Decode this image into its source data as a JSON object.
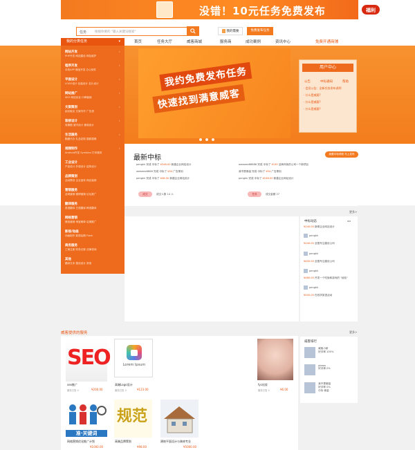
{
  "top_banner": {
    "headline": "没错！10元任务免费发布",
    "badge": "福利"
  },
  "search": {
    "select_label": "任务",
    "placeholder": "搜搜你要的 \"输入关键词搜索\"",
    "button_icon": "search-icon"
  },
  "header_buttons": {
    "publish_label": "我的需要",
    "register_label": "免费发布任务"
  },
  "nav": {
    "category_label": "我的分类任务",
    "items": [
      "首页",
      "任务大厅",
      "威客商城",
      "服务商",
      "成功案例",
      "资讯中心"
    ],
    "highlight": "免费开通商铺"
  },
  "sidebar": {
    "groups": [
      {
        "title": "网站开发",
        "items": "PHP开发  网站建设  网站维护"
      },
      {
        "title": "程序开发",
        "items": "手机APP  微信开发  办公软件"
      },
      {
        "title": "平面设计",
        "items": "LOGO设计  包装设计  名片设计"
      },
      {
        "title": "网站推广",
        "items": "SEO  网站优化  口碑营销"
      },
      {
        "title": "文案策划",
        "items": "起名取名  文案写作  广告语"
      },
      {
        "title": "装修设计",
        "items": "效果图  室内设计  景观设计"
      },
      {
        "title": "生活服务",
        "items": "跑腿代办  礼品定制  摄影摄像"
      },
      {
        "title": "视频制作",
        "items": "Android开发  Symbian  打印服务"
      },
      {
        "title": "工业设计",
        "items": "产品设计  外观设计  结构设计"
      },
      {
        "title": "品牌策划",
        "items": "活动策划  企业宣传  网店装修"
      },
      {
        "title": "营销服务",
        "items": "全网营销  微博营销  论坛推广"
      },
      {
        "title": "翻译服务",
        "items": "英语翻译  日语翻译  韩语翻译"
      },
      {
        "title": "网络营销",
        "items": "微信营销  淘宝刷单  店铺推广"
      },
      {
        "title": "影视/动画",
        "items": "动画制作  影视后期  Flash"
      },
      {
        "title": "商务服务",
        "items": "工商注册  财务记账  法律咨询"
      },
      {
        "title": "其他",
        "items": "翻译文本  整站设计  其他"
      }
    ]
  },
  "hero": {
    "line1": "我约免费发布任务",
    "line2": "快速找到满意威客"
  },
  "user_panel": {
    "title": "用户中心",
    "tabs": [
      "公告",
      "中标通知",
      "帮助"
    ],
    "items": [
      "· 会员公告：全新任务发布说明",
      "· 什么是威客?",
      "· 什么是威客?",
      "· 什么是威客?"
    ]
  },
  "latest": {
    "title": "最新中标",
    "action_label": "我要中标领钱  马上发布",
    "rows": [
      {
        "text": "pengkk 完成 中标了",
        "amount": "¥248.00",
        "tail": "新建企业网站设计"
      },
      {
        "text": "weweee6666 完成 中标了",
        "amount": "¥54",
        "tail": "广告策划"
      },
      {
        "text": "pengkk 完成 中标了",
        "amount": "¥48.00",
        "tail": "新建企业网站设计"
      },
      {
        "text": "weweee88888 完成 中标了",
        "amount": "¥135",
        "tail": "这两年我的公司一个新项目"
      },
      {
        "text": "我不是佛祖 完成 中标了",
        "amount": "¥54",
        "tail": "广告策划"
      },
      {
        "text": "pengkk 完成 中标了",
        "amount": "¥248.00",
        "tail": "新建企业网站设计"
      }
    ],
    "stat1_label": "成交",
    "stat1_text": "成交人数 14 人",
    "stat2_label": "任务",
    "stat2_text": "成交金额 27"
  },
  "more_label": "更多>",
  "activity": {
    "title": "中标动态",
    "rows": [
      {
        "amount": "¥240.00",
        "text": "新闻企业网站设计"
      },
      {
        "user": "pengkk",
        "amount": "¥240.00",
        "text": "全国专注建设公司"
      },
      {
        "user": "pengkk",
        "amount": "¥400.00",
        "text": "全国专注建设公司"
      },
      {
        "user": "pengkk",
        "amount": "¥480.00",
        "text": "开发一个吃饭和游戏的 \"经验\""
      },
      {
        "user": "pengkk",
        "amount": "¥500.00",
        "text": "在线学英语活动"
      }
    ]
  },
  "services": {
    "title": "威客提供的服务",
    "products": [
      {
        "name": "seo推广",
        "meta": "服务已售 0",
        "price": "¥200.00"
      },
      {
        "name": "高端Logo设计",
        "meta": "服务已售 0",
        "price": "¥123.00"
      },
      {
        "name": "fyc化妆",
        "meta": "服务已售 0",
        "price": "¥6.00"
      },
      {
        "name": "网络营销优化推广计划",
        "meta": "服务已售 0",
        "price": "¥1000.00"
      },
      {
        "name": "高端品牌策划",
        "meta": "服务已售 0",
        "price": "¥98.00"
      },
      {
        "name": "建筑平面设计与装修专业",
        "meta": "服务已售 0",
        "price": "¥5000.00"
      }
    ],
    "seo_text": "SEO",
    "logo_caption": "Lorem Ipsum",
    "zhun_text": "准·关键词",
    "calli_text": "规范"
  },
  "ranking": {
    "title": "威客排行",
    "rows": [
      {
        "name": "威客小新",
        "meta": "好评率 100%"
      },
      {
        "name": "pbeas",
        "meta": "好评率 0%"
      },
      {
        "name": "我不是佛祖",
        "meta": "好评率 0%",
        "tags": "中标  佣金"
      }
    ]
  },
  "colors": {
    "brand": "#f47a1f",
    "brand_dark": "#e9550f",
    "sidebar": "#ee6a1c"
  }
}
